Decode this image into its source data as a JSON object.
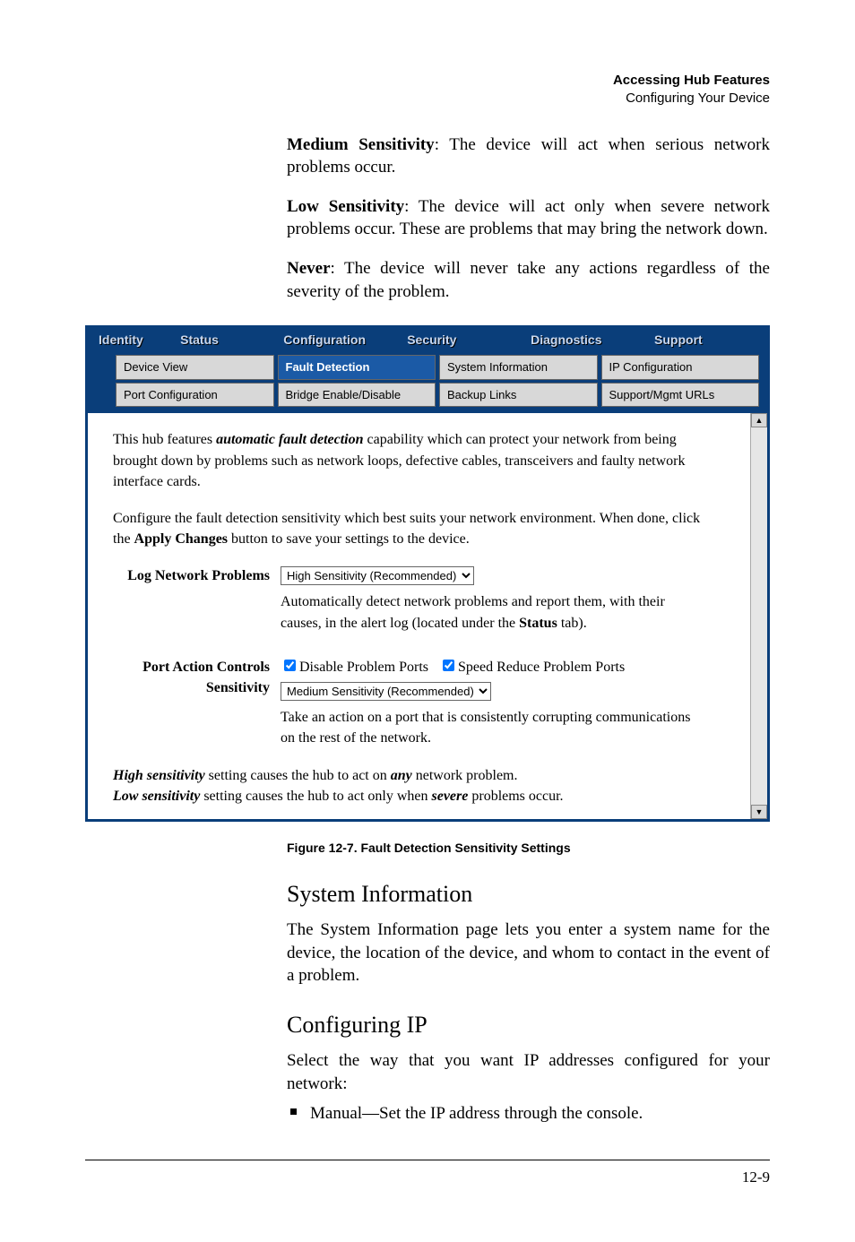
{
  "header": {
    "title_bold": "Accessing Hub Features",
    "subtitle": "Configuring Your Device"
  },
  "intro_paras": [
    {
      "lead": "Medium Sensitivity",
      "rest": ": The device will act when serious network problems occur."
    },
    {
      "lead": "Low Sensitivity",
      "rest": ": The device will act only when severe network problems occur. These are problems that may bring the network down."
    },
    {
      "lead": "Never",
      "rest": ": The device will never take any actions regardless of the severity of the problem."
    }
  ],
  "app": {
    "tabs": [
      "Identity",
      "Status",
      "Configuration",
      "Security",
      "Diagnostics",
      "Support"
    ],
    "active_tab_index": 2,
    "buttons_row1": [
      "Device View",
      "Fault Detection",
      "System Information",
      "IP Configuration"
    ],
    "buttons_row2": [
      "Port Configuration",
      "Bridge Enable/Disable",
      "Backup Links",
      "Support/Mgmt URLs"
    ],
    "active_button_index": 1,
    "para1_pre": "This hub features ",
    "para1_em": "automatic fault detection",
    "para1_post": " capability which can protect your network from being brought down by problems such as network loops, defective cables, transceivers and faulty network interface cards.",
    "para2_pre": "Configure the fault detection sensitivity which best suits your network environment. When done, click the ",
    "para2_bold": "Apply Changes",
    "para2_post": " button to save your settings to the device.",
    "log_label": "Log Network Problems",
    "log_option": "High Sensitivity (Recommended)",
    "log_help_pre": "Automatically detect network problems and report them, with their causes, in the alert log (located under the ",
    "log_help_bold": "Status",
    "log_help_post": " tab).",
    "port_label_line1": "Port Action Controls",
    "port_label_line2": "Sensitivity",
    "cb1_label": "Disable Problem Ports",
    "cb2_label": "Speed Reduce Problem Ports",
    "port_option": "Medium Sensitivity (Recommended)",
    "port_help": "Take an action on a port that is consistently corrupting communications on the rest of the network.",
    "foot_hi_em": "High sensitivity",
    "foot_hi_mid": " setting causes the hub to act on ",
    "foot_hi_em2": "any",
    "foot_hi_post": " network problem.",
    "foot_lo_em": "Low sensitivity",
    "foot_lo_mid": " setting causes the hub to act only when ",
    "foot_lo_em2": "severe",
    "foot_lo_post": " problems occur."
  },
  "figcaption": "Figure 12-7. Fault Detection Sensitivity Settings",
  "sections": {
    "sysinfo_title": "System Information",
    "sysinfo_body": "The System Information page lets you enter a system name for the device, the location of the device, and whom to contact in the event of a problem.",
    "ip_title": "Configuring IP",
    "ip_body": "Select the way that you want IP addresses configured for your network:",
    "ip_bullet1": "Manual—Set the IP address through the console."
  },
  "pagenum": "12-9"
}
